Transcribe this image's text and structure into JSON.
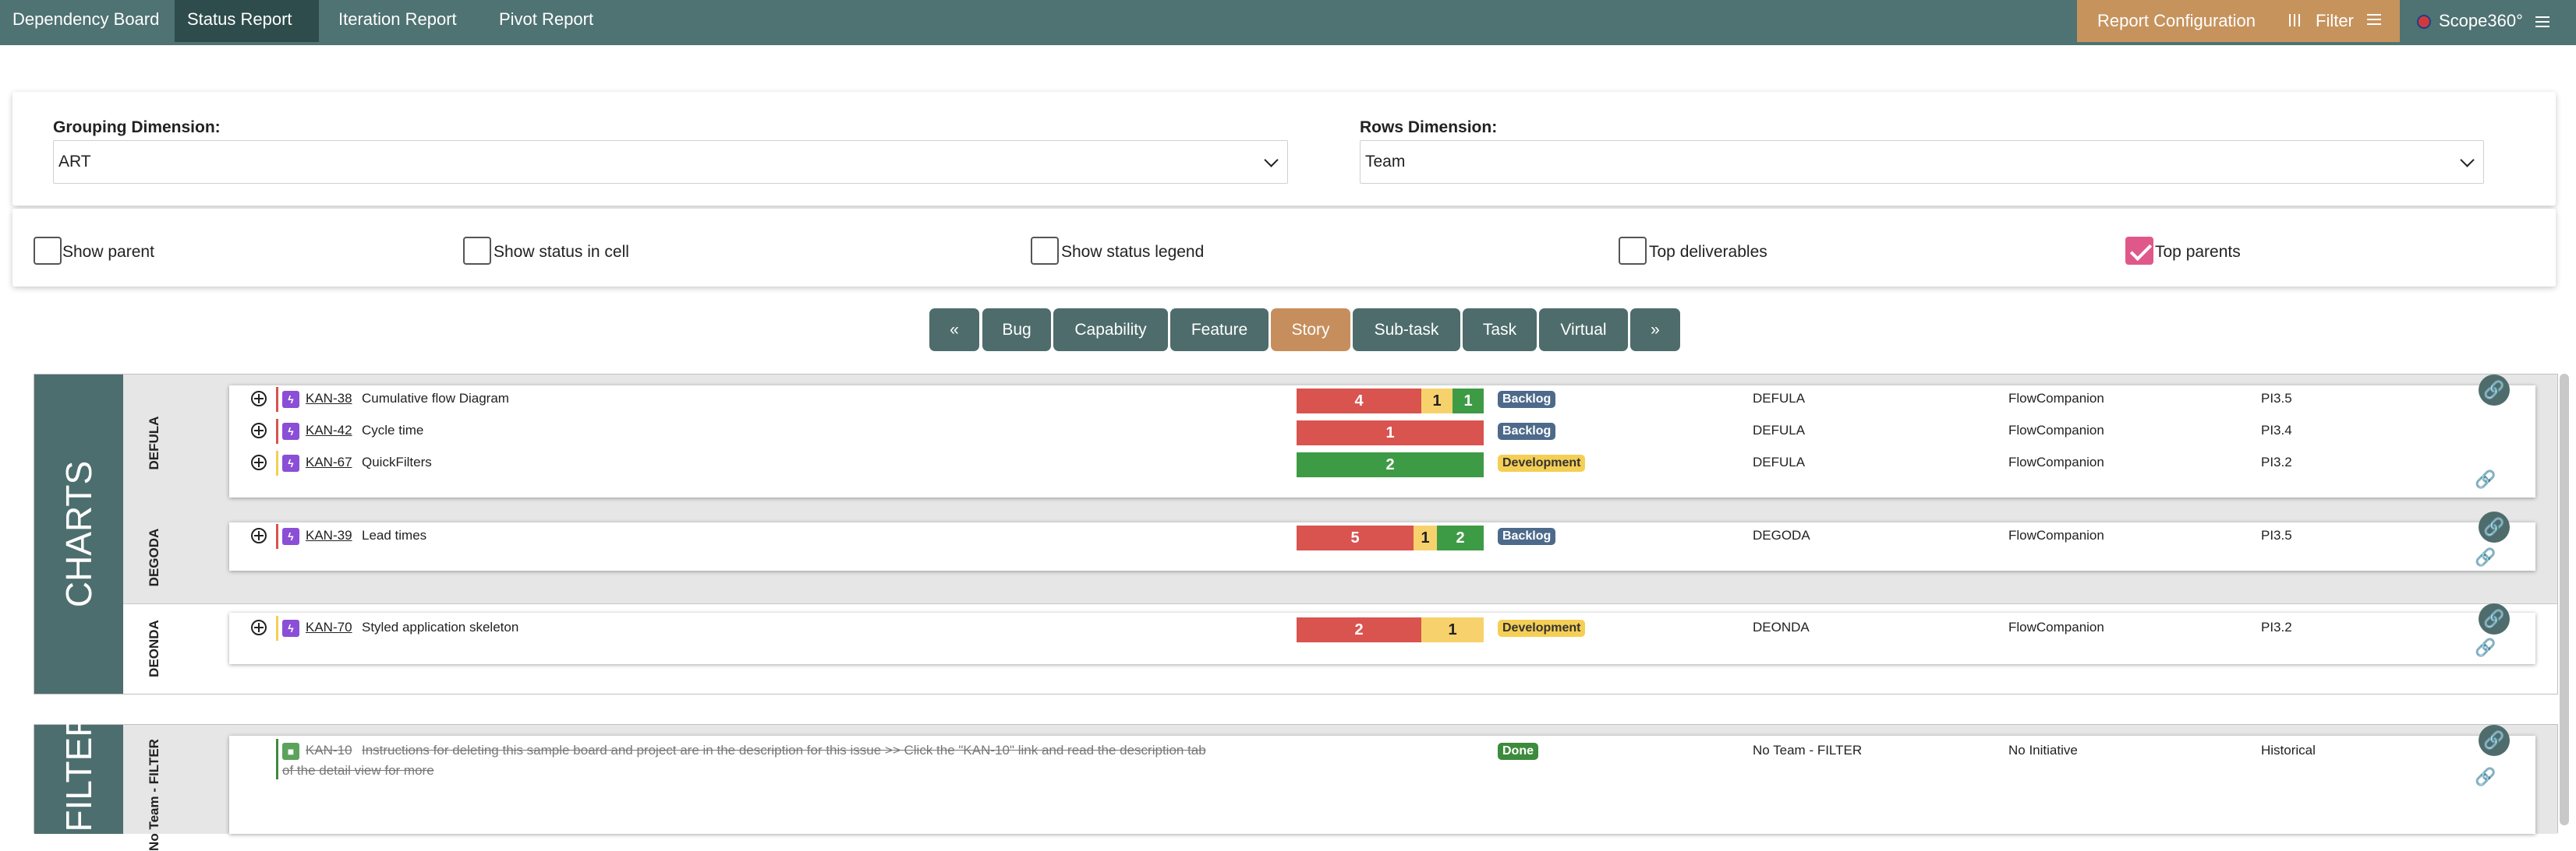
{
  "nav": {
    "tabs": [
      "Dependency Board",
      "Status Report",
      "Iteration Report",
      "Pivot Report"
    ],
    "active_tab": "Status Report",
    "report_configuration": "Report Configuration",
    "filter": "Filter",
    "brand": "Scope360°"
  },
  "dimensions": {
    "grouping_label": "Grouping Dimension:",
    "grouping_value": "ART",
    "rows_label": "Rows Dimension:",
    "rows_value": "Team"
  },
  "options": [
    {
      "label": "Show parent",
      "checked": false
    },
    {
      "label": "Show status in cell",
      "checked": false
    },
    {
      "label": "Show status legend",
      "checked": false
    },
    {
      "label": "Top deliverables",
      "checked": false
    },
    {
      "label": "Top parents",
      "checked": true
    }
  ],
  "types": {
    "prev": "«",
    "next": "»",
    "items": [
      "Bug",
      "Capability",
      "Feature",
      "Story",
      "Sub-task",
      "Task",
      "Virtual"
    ],
    "active": "Story"
  },
  "groups": [
    {
      "title": "CHARTS",
      "rows": [
        {
          "label": "DEFULA",
          "issues": [
            {
              "key": "KAN-38",
              "summary": "Cumulative flow Diagram",
              "counts": {
                "red": 4,
                "yellow": 1,
                "green": 1
              },
              "status": "Backlog",
              "team": "DEFULA",
              "initiative": "FlowCompanion",
              "pi": "PI3.5"
            },
            {
              "key": "KAN-42",
              "summary": "Cycle time",
              "counts": {
                "red": 1
              },
              "status": "Backlog",
              "team": "DEFULA",
              "initiative": "FlowCompanion",
              "pi": "PI3.4"
            },
            {
              "key": "KAN-67",
              "summary": "QuickFilters",
              "counts": {
                "green": 2
              },
              "status": "Development",
              "team": "DEFULA",
              "initiative": "FlowCompanion",
              "pi": "PI3.2"
            }
          ]
        },
        {
          "label": "DEGODA",
          "issues": [
            {
              "key": "KAN-39",
              "summary": "Lead times",
              "counts": {
                "red": 5,
                "yellow": 1,
                "green": 2
              },
              "status": "Backlog",
              "team": "DEGODA",
              "initiative": "FlowCompanion",
              "pi": "PI3.5"
            }
          ]
        },
        {
          "label": "DEONDA",
          "issues": [
            {
              "key": "KAN-70",
              "summary": "Styled application skeleton",
              "counts": {
                "red": 2,
                "yellow": 1
              },
              "status": "Development",
              "team": "DEONDA",
              "initiative": "FlowCompanion",
              "pi": "PI3.2"
            }
          ]
        }
      ]
    },
    {
      "title": "FILTER",
      "rows": [
        {
          "label": "No Team - FILTER",
          "issues": [
            {
              "key": "KAN-10",
              "summary": "Instructions for deleting this sample board and project are in the description for this issue >> Click the \"KAN-10\" link and read the description tab",
              "summary_cont": "of the detail view for more",
              "status": "Done",
              "team": "No Team - FILTER",
              "initiative": "No Initiative",
              "pi": "Historical"
            }
          ]
        }
      ]
    }
  ],
  "colors": {
    "header": "#4f7272",
    "accent": "#c6935d",
    "story_icon": "#8a4fd6",
    "done_icon": "#5ba35b",
    "backlog": "#4d6a8a",
    "development": "#f5cf55",
    "done": "#3d8b3d"
  }
}
